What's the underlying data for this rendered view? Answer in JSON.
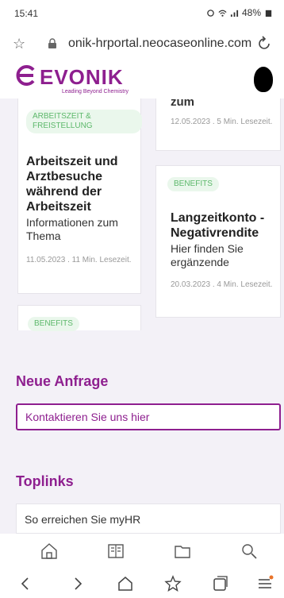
{
  "status": {
    "time": "15:41",
    "battery": "48%"
  },
  "browser": {
    "url": "onik-hrportal.neocaseonline.com"
  },
  "brand": {
    "name": "EVONIK",
    "tagline": "Leading Beyond Chemistry",
    "color": "#8e1f8f"
  },
  "cards": [
    {
      "badge": "ARBEITSZEIT & FREISTELLUNG",
      "title": "Arbeitszeit und Arztbesuche während der Arbeitszeit",
      "subtitle": "Informationen zum Thema",
      "meta": "11.05.2023 . 11 Min. Lesezeit."
    },
    {
      "title_fragment": "zum",
      "meta": "12.05.2023 . 5 Min. Lesezeit."
    },
    {
      "badge": "BENEFITS",
      "title": "Langzeitkonto - Negativrendite",
      "subtitle": "Hier finden Sie ergänzende",
      "meta": "20.03.2023 . 4 Min. Lesezeit."
    },
    {
      "badge": "BENEFITS"
    }
  ],
  "neue_anfrage": {
    "title": "Neue Anfrage",
    "contact_label": "Kontaktieren Sie uns hier"
  },
  "toplinks": {
    "title": "Toplinks",
    "items": [
      "So erreichen Sie myHR"
    ]
  }
}
